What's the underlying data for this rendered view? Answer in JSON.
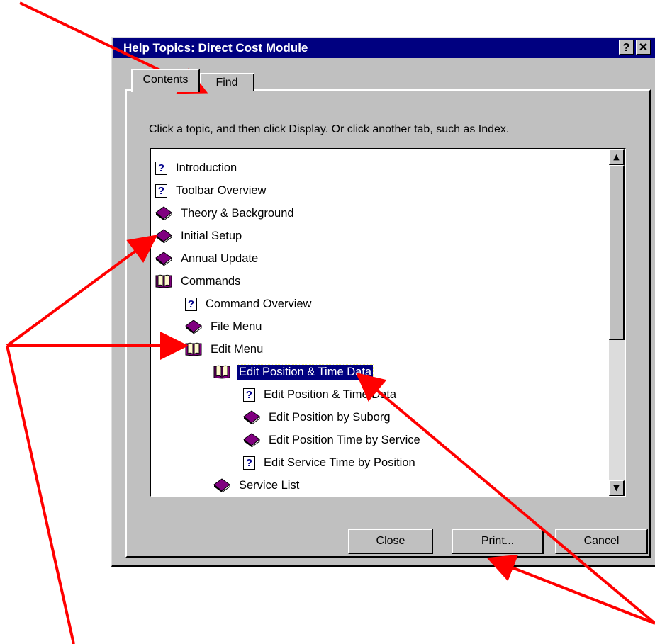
{
  "window": {
    "title": "Help Topics: Direct Cost Module",
    "help_button": "?",
    "close_button": "✕"
  },
  "tabs": [
    {
      "label": "Contents",
      "active": true
    },
    {
      "label": "Find",
      "active": false
    }
  ],
  "instruction": "Click a topic, and then click Display. Or click another tab, such as Index.",
  "tree": [
    {
      "label": "Introduction",
      "icon": "help-page-icon",
      "level": 0
    },
    {
      "label": "Toolbar Overview",
      "icon": "help-page-icon",
      "level": 0
    },
    {
      "label": "Theory & Background",
      "icon": "closed-book-icon",
      "level": 0
    },
    {
      "label": "Initial Setup",
      "icon": "closed-book-icon",
      "level": 0
    },
    {
      "label": "Annual Update",
      "icon": "closed-book-icon",
      "level": 0
    },
    {
      "label": "Commands",
      "icon": "open-book-icon",
      "level": 0
    },
    {
      "label": "Command Overview",
      "icon": "help-page-icon",
      "level": 1
    },
    {
      "label": "File Menu",
      "icon": "closed-book-icon",
      "level": 1
    },
    {
      "label": "Edit Menu",
      "icon": "open-book-icon",
      "level": 1
    },
    {
      "label": "Edit Position & Time Data",
      "icon": "open-book-icon",
      "level": 2,
      "selected": true
    },
    {
      "label": "Edit Position & Time Data",
      "icon": "help-page-icon",
      "level": 3
    },
    {
      "label": "Edit Position by Suborg",
      "icon": "closed-book-icon",
      "level": 3
    },
    {
      "label": "Edit Position Time by Service",
      "icon": "closed-book-icon",
      "level": 3
    },
    {
      "label": "Edit Service Time by Position",
      "icon": "help-page-icon",
      "level": 3
    },
    {
      "label": "Service List",
      "icon": "closed-book-icon",
      "level": 2
    }
  ],
  "buttons": {
    "close": "Close",
    "print": "Print...",
    "cancel": "Cancel"
  },
  "colors": {
    "titlebar": "#000080",
    "dialog": "#c0c0c0",
    "book": "#800080",
    "annotation_arrow": "#ff0000"
  }
}
